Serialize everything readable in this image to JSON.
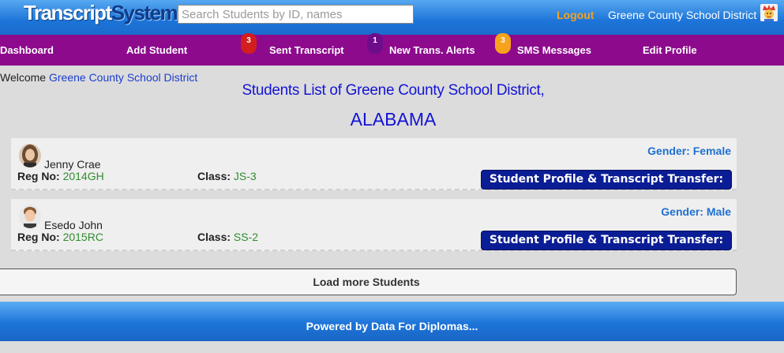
{
  "header": {
    "logo_part1": "Transcript",
    "logo_part2": "System",
    "search_placeholder": "Search Students by ID, names",
    "logout_label": "Logout",
    "district_name": "Greene County School District",
    "user_icon": "user-avatar-icon"
  },
  "nav": {
    "items": [
      {
        "label": "Dashboard"
      },
      {
        "label": "Add Student"
      },
      {
        "label": "Sent Transcript",
        "badge": "3",
        "badge_color": "#d21e1e"
      },
      {
        "label": "New Trans. Alerts",
        "badge": "1",
        "badge_color": "#6e0d8c"
      },
      {
        "label": "SMS Messages",
        "badge": "3",
        "badge_color": "#f6a21c"
      },
      {
        "label": "Edit Profile"
      }
    ]
  },
  "welcome": {
    "prefix": "Welcome",
    "district": "Greene County School District"
  },
  "page": {
    "title_line1": "Students List of Greene County School District,",
    "title_line2": "ALABAMA"
  },
  "students": [
    {
      "name": "Jenny Crae",
      "reg_label": "Reg No:",
      "reg_no": "2014GH",
      "class_label": "Class:",
      "class": "JS-3",
      "gender_label": "Gender:",
      "gender": "Female",
      "action_label": "Student Profile & Transcript Transfer:"
    },
    {
      "name": "Esedo John",
      "reg_label": "Reg No:",
      "reg_no": "2015RC",
      "class_label": "Class:",
      "class": "SS-2",
      "gender_label": "Gender:",
      "gender": "Male",
      "action_label": "Student Profile & Transcript Transfer:"
    }
  ],
  "load_more_label": "Load more Students",
  "footer": {
    "text": "Powered by Data For Diplomas..."
  },
  "colors": {
    "header_blue": "#1d74d8",
    "nav_purple": "#8d0a8d",
    "heading_blue": "#1414d6",
    "link_blue": "#1c3dcc",
    "button_navy": "#0b1d94",
    "value_green": "#2f8d2f",
    "logout_orange": "#f7a21b"
  }
}
